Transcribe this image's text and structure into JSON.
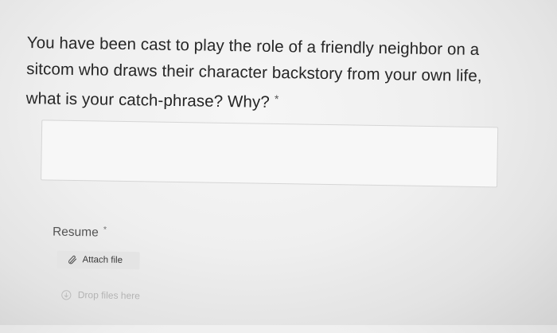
{
  "question": {
    "lines": [
      "You have been cast to play the role of a friendly neighbor on a",
      "sitcom who draws their character backstory from your own life,",
      "what is your catch-phrase?  Why?"
    ],
    "required_marker": "*",
    "answer_value": ""
  },
  "resume": {
    "label": "Resume",
    "required_marker": "*",
    "attach_label": "Attach file",
    "drop_label": "Drop files here"
  }
}
